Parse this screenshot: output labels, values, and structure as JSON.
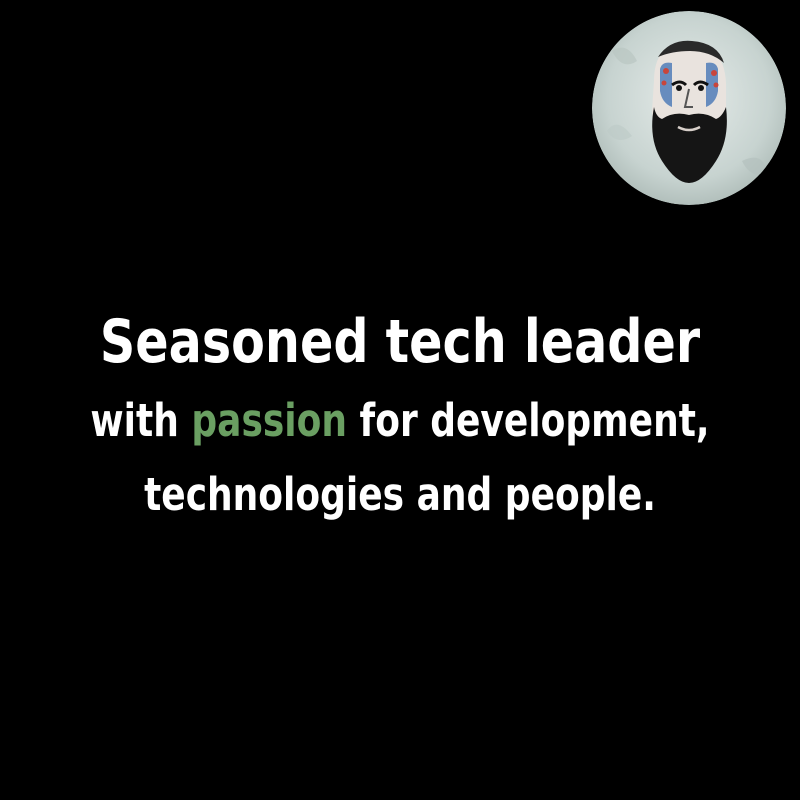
{
  "avatar": {
    "icon": "bearded-man-portrait-icon",
    "background_color": "#cfd8d6"
  },
  "headline": {
    "line1": "Seasoned tech leader",
    "line2_pre": "with ",
    "line2_accent": "passion",
    "line2_post": " for development,",
    "line3": "technologies and people."
  },
  "colors": {
    "background": "#000000",
    "text": "#ffffff",
    "accent": "#6a9f62"
  }
}
